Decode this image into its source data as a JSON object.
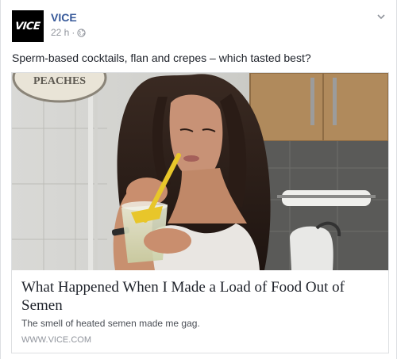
{
  "post": {
    "avatar_text": "VICE",
    "page_name": "VICE",
    "timestamp": "22 h",
    "separator": "·",
    "privacy_icon": "globe-icon",
    "menu_icon": "chevron-down-icon",
    "caption": "Sperm-based cocktails, flan and crepes – which tasted best?"
  },
  "link_card": {
    "image_sign_text": "PEACHES",
    "title": "What Happened When I Made a Load of Food Out of Semen",
    "description": "The smell of heated semen made me gag.",
    "domain": "WWW.VICE.COM"
  },
  "colors": {
    "page_name": "#365899",
    "meta": "#90949c",
    "text": "#1d2129",
    "border": "#dddfe2"
  }
}
